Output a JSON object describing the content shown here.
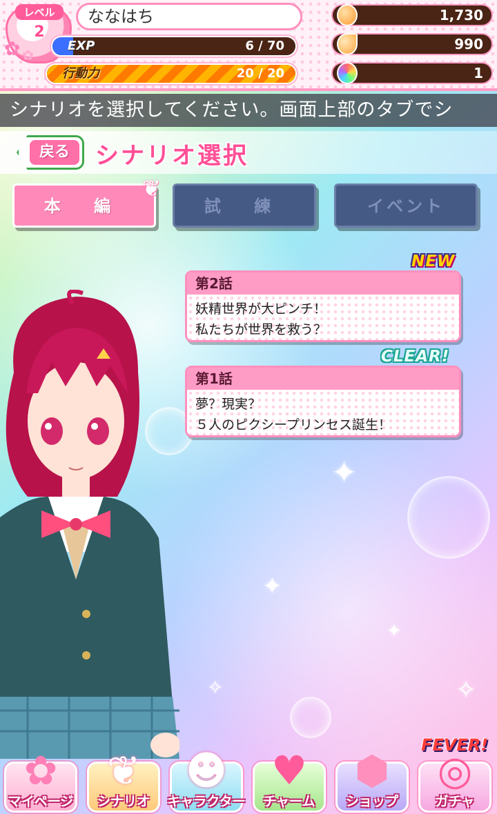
{
  "status": {
    "level_label": "レベル",
    "level_value": "2",
    "player_name": "ななはち",
    "exp_label": "EXP",
    "exp_value": "6 / 70",
    "exp_progress": 0.0857,
    "action_label": "行動力",
    "action_value": "20 / 20",
    "action_progress": 1.0,
    "currencies": [
      {
        "icon": "coin-icon",
        "amount": "1,730"
      },
      {
        "icon": "cone-icon",
        "amount": "990"
      },
      {
        "icon": "rainbow-gem-icon",
        "amount": "1"
      }
    ]
  },
  "ticker": {
    "text": "シナリオを選択してください。画面上部のタブでシ"
  },
  "header": {
    "back_label": "戻る",
    "title": "シナリオ選択"
  },
  "tabs": [
    {
      "label": "本 編",
      "active": true
    },
    {
      "label": "試 練",
      "active": false
    },
    {
      "label": "イベント",
      "active": false
    }
  ],
  "episodes": [
    {
      "number": "第2話",
      "line1": "妖精世界が大ピンチ！",
      "line2": "私たちが世界を救う？",
      "badge": "NEW"
    },
    {
      "number": "第1話",
      "line1": "夢？現実？",
      "line2": "５人のピクシープリンセス誕生！",
      "badge": "CLEAR!"
    }
  ],
  "bottom_nav": {
    "fever_label": "FEVER!",
    "items": [
      {
        "label": "マイページ",
        "icon": "flower-icon"
      },
      {
        "label": "シナリオ",
        "icon": "wing-icon"
      },
      {
        "label": "キャラクター",
        "icon": "character-icon"
      },
      {
        "label": "チャーム",
        "icon": "heart-star-icon"
      },
      {
        "label": "ショップ",
        "icon": "gem-icon"
      },
      {
        "label": "ガチャ",
        "icon": "gacha-icon"
      }
    ]
  },
  "colors": {
    "accent_pink": "#ff8ab9",
    "tab_inactive": "#465a86",
    "exp_fill": "#3b6fff",
    "action_fill": "#ffb400"
  }
}
